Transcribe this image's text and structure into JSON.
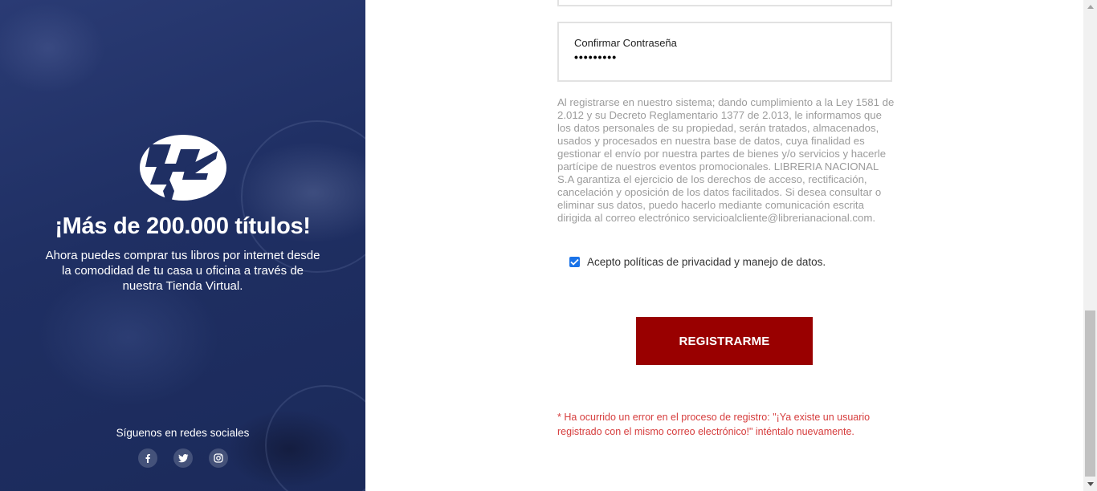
{
  "hero": {
    "title": "¡Más de 200.000 títulos!",
    "text": "Ahora puedes comprar tus libros por internet desde la comodidad de tu casa u oficina a través de nuestra Tienda Virtual."
  },
  "social": {
    "title": "Síguenos en redes sociales",
    "icons": [
      "facebook-icon",
      "twitter-icon",
      "instagram-icon"
    ]
  },
  "form": {
    "confirm_password_label": "Confirmar Contraseña",
    "confirm_password_value": "•••••••••",
    "legal_text": "Al registrarse en nuestro sistema; dando cumplimiento a la Ley 1581 de 2.012 y su Decreto Reglamentario 1377 de 2.013, le informamos que los datos personales de su propiedad, serán tratados, almacenados, usados y procesados en nuestra base de datos, cuya finalidad es gestionar el envío por nuestra partes de bienes y/o servicios y hacerle partícipe de nuestros eventos promocionales. LIBRERIA NACIONAL S.A garantiza el ejercicio de los derechos de acceso, rectificación, cancelación y oposición de los datos facilitados. Si desea consultar o eliminar sus datos, puedo hacerlo mediante comunicación escrita dirigida al correo electrónico servicioalcliente@librerianacional.com.",
    "accept_label": "Acepto políticas de privacidad y manejo de datos.",
    "accept_checked": true,
    "submit_label": "REGISTRARME",
    "error_message": "* Ha ocurrido un error en el proceso de registro: \"¡Ya existe un usuario registrado con el mismo correo electrónico!\" inténtalo nuevamente."
  },
  "colors": {
    "panel": "#1f2f63",
    "button": "#990000",
    "error": "#d63d3d",
    "checkbox": "#1a73e8"
  }
}
